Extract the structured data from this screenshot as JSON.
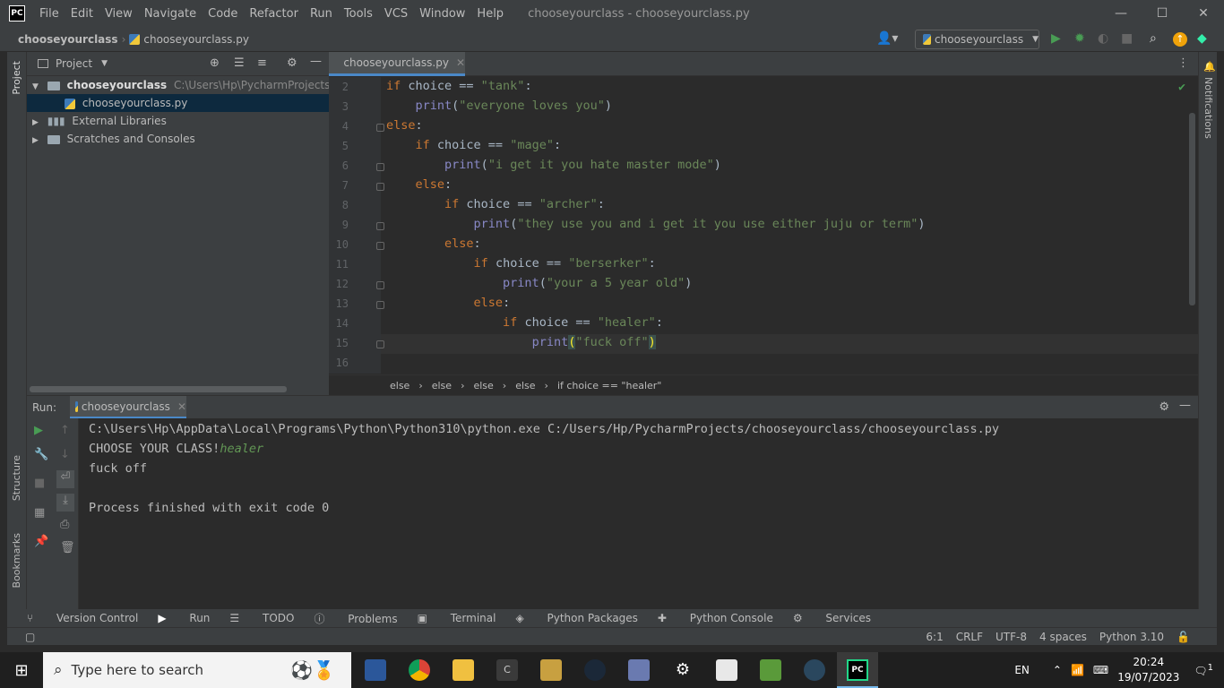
{
  "titlebar": {
    "logo": "PC",
    "menu": [
      "File",
      "Edit",
      "View",
      "Navigate",
      "Code",
      "Refactor",
      "Run",
      "Tools",
      "VCS",
      "Window",
      "Help"
    ],
    "title": "chooseyourclass - chooseyourclass.py",
    "controls": {
      "minimize": "—",
      "maximize": "☐",
      "close": "✕"
    }
  },
  "navbar": {
    "project": "chooseyourclass",
    "file": "chooseyourclass.py",
    "run_config": "chooseyourclass"
  },
  "side": {
    "project_label": "Project",
    "structure_label": "Structure",
    "bookmarks_label": "Bookmarks",
    "notifications_label": "Notifications"
  },
  "project_panel": {
    "title": "Project",
    "root_name": "chooseyourclass",
    "root_path": "C:\\Users\\Hp\\PycharmProjects\\choose",
    "file": "chooseyourclass.py",
    "external": "External Libraries",
    "scratches": "Scratches and Consoles"
  },
  "editor": {
    "tab": "chooseyourclass.py",
    "line_numbers": [
      "2",
      "3",
      "4",
      "5",
      "6",
      "7",
      "8",
      "9",
      "10",
      "11",
      "12",
      "13",
      "14",
      "15",
      "16"
    ],
    "lines": [
      {
        "indent": "",
        "kw": "if ",
        "a": "choice == ",
        "str": "\"tank\"",
        "b": ":"
      },
      {
        "indent": "    ",
        "fn": "print",
        "a": "(",
        "str": "\"everyone loves you\"",
        "b": ")"
      },
      {
        "indent": "",
        "kw": "else",
        "b": ":"
      },
      {
        "indent": "    ",
        "kw": "if ",
        "a": "choice == ",
        "str": "\"mage\"",
        "b": ":"
      },
      {
        "indent": "        ",
        "fn": "print",
        "a": "(",
        "str": "\"i get it you hate master mode\"",
        "b": ")"
      },
      {
        "indent": "    ",
        "kw": "else",
        "b": ":"
      },
      {
        "indent": "        ",
        "kw": "if ",
        "a": "choice == ",
        "str": "\"archer\"",
        "b": ":"
      },
      {
        "indent": "            ",
        "fn": "print",
        "a": "(",
        "str": "\"they use you and i get it you use either juju or term\"",
        "b": ")"
      },
      {
        "indent": "        ",
        "kw": "else",
        "b": ":"
      },
      {
        "indent": "            ",
        "kw": "if ",
        "a": "choice == ",
        "str": "\"berserker\"",
        "b": ":"
      },
      {
        "indent": "                ",
        "fn": "print",
        "a": "(",
        "str": "\"your a 5 year old\"",
        "b": ")"
      },
      {
        "indent": "            ",
        "kw": "else",
        "b": ":"
      },
      {
        "indent": "                ",
        "kw": "if ",
        "a": "choice == ",
        "str": "\"healer\"",
        "b": ":"
      },
      {
        "indent": "                    ",
        "fn": "print",
        "a": "(",
        "str": "\"fuck off\"",
        "b": ")"
      },
      {
        "indent": ""
      }
    ],
    "breadcrumbs": [
      "else",
      "else",
      "else",
      "else",
      "if choice == \"healer\""
    ]
  },
  "run_panel": {
    "label": "Run:",
    "tab": "chooseyourclass",
    "console": {
      "cmd": "C:\\Users\\Hp\\AppData\\Local\\Programs\\Python\\Python310\\python.exe C:/Users/Hp/PycharmProjects/chooseyourclass/chooseyourclass.py",
      "prompt": "CHOOSE YOUR CLASS!",
      "input": "healer",
      "output": "fuck off",
      "exit": "Process finished with exit code 0"
    }
  },
  "toolwindows": [
    "Version Control",
    "Run",
    "TODO",
    "Problems",
    "Terminal",
    "Python Packages",
    "Python Console",
    "Services"
  ],
  "statusbar": [
    "6:1",
    "CRLF",
    "UTF-8",
    "4 spaces",
    "Python 3.10"
  ],
  "taskbar": {
    "search_placeholder": "Type here to search",
    "lang": "EN",
    "time": "20:24",
    "date": "19/07/2023",
    "notif_count": "1"
  },
  "colors": {
    "accent": "#4a88c7",
    "keyword": "#cc7832",
    "string": "#6a8759",
    "builtin": "#8888c6",
    "run_green": "#499c54"
  }
}
